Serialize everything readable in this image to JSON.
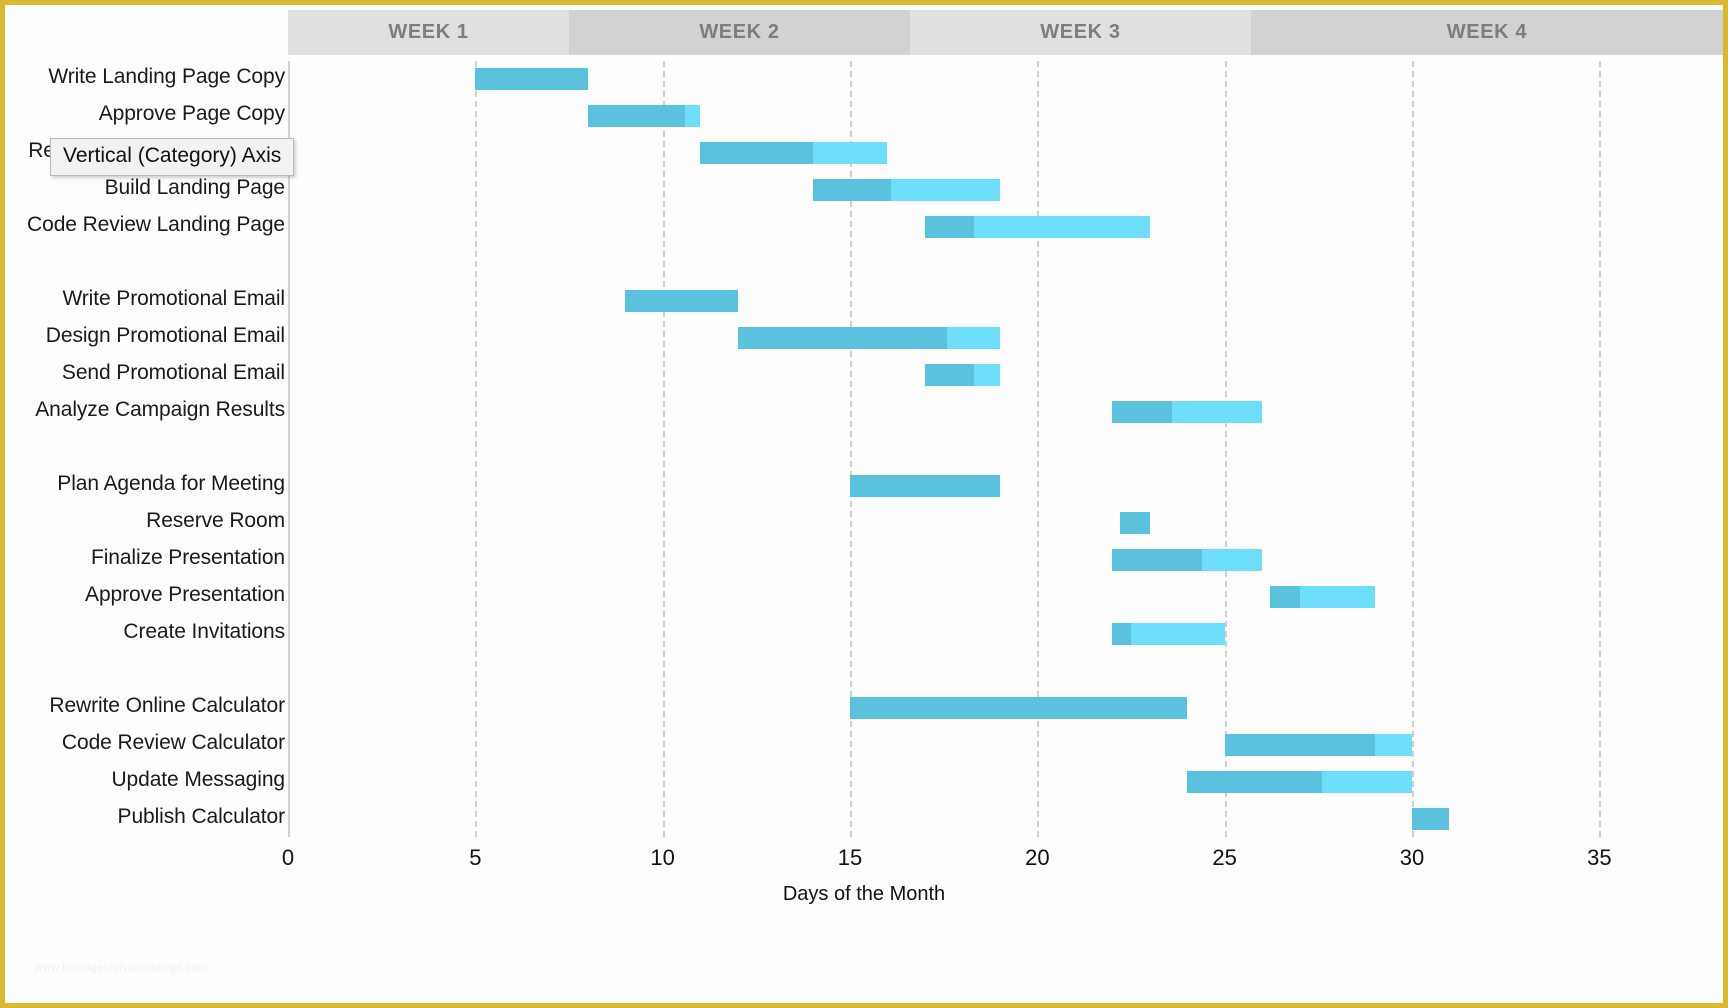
{
  "chart_data": {
    "type": "bar",
    "subtype": "gantt",
    "title": "",
    "xlabel": "Days of the Month",
    "ylabel": "",
    "xlim": [
      0,
      38.3
    ],
    "xticks": [
      0,
      5,
      10,
      15,
      20,
      25,
      30,
      35
    ],
    "xtick_labels": [
      "0",
      "5",
      "10",
      "15",
      "20",
      "25",
      "30",
      "35"
    ],
    "grid": true,
    "gridlines_at": [
      5,
      10,
      15,
      20,
      25,
      30,
      35
    ],
    "legend": [],
    "colors": {
      "complete": "#5BC2DD",
      "remaining": "#6FDEFA",
      "border": "#D8B930",
      "header_light": "#E0E0E0",
      "header_dark": "#D2D2D2",
      "header_text": "#7D7D7D",
      "gridline": "#D3D3D3"
    },
    "week_bands": [
      {
        "label": "WEEK 1",
        "start_day": 0,
        "end_day": 7.5,
        "shade": "light"
      },
      {
        "label": "WEEK 2",
        "start_day": 7.5,
        "end_day": 16.6,
        "shade": "dark"
      },
      {
        "label": "WEEK 3",
        "start_day": 16.6,
        "end_day": 25.7,
        "shade": "light"
      },
      {
        "label": "WEEK 4",
        "start_day": 25.7,
        "end_day": 38.3,
        "shade": "dark"
      }
    ],
    "categories": [
      "Write Landing Page Copy",
      "Approve Page Copy",
      "Review Landing Page Copy",
      "Build Landing Page",
      "Code Review Landing Page",
      "",
      "Write Promotional Email",
      "Design Promotional Email",
      "Send Promotional Email",
      "Analyze Campaign Results",
      "",
      "Plan Agenda for Meeting",
      "Reserve Room",
      "Finalize Presentation",
      "Approve Presentation",
      "Create Invitations",
      "",
      "Rewrite Online Calculator",
      "Code Review Calculator",
      "Update Messaging",
      "Publish Calculator"
    ],
    "tasks": [
      {
        "name": "Write Landing Page Copy",
        "start": 5.0,
        "complete_end": 8.0,
        "end": 8.0
      },
      {
        "name": "Approve Page Copy",
        "start": 8.0,
        "complete_end": 10.6,
        "end": 11.0
      },
      {
        "name": "Review Landing Page Copy",
        "start": 11.0,
        "complete_end": 14.0,
        "end": 16.0
      },
      {
        "name": "Build Landing Page",
        "start": 14.0,
        "complete_end": 16.1,
        "end": 19.0
      },
      {
        "name": "Code Review Landing Page",
        "start": 17.0,
        "complete_end": 18.3,
        "end": 23.0
      },
      {
        "name": "Write Promotional Email",
        "start": 9.0,
        "complete_end": 12.0,
        "end": 12.0
      },
      {
        "name": "Design Promotional Email",
        "start": 12.0,
        "complete_end": 17.6,
        "end": 19.0
      },
      {
        "name": "Send Promotional Email",
        "start": 17.0,
        "complete_end": 18.3,
        "end": 19.0
      },
      {
        "name": "Analyze Campaign Results",
        "start": 22.0,
        "complete_end": 23.6,
        "end": 26.0
      },
      {
        "name": "Plan Agenda for Meeting",
        "start": 15.0,
        "complete_end": 19.0,
        "end": 19.0
      },
      {
        "name": "Reserve Room",
        "start": 22.2,
        "complete_end": 23.0,
        "end": 23.0
      },
      {
        "name": "Finalize Presentation",
        "start": 22.0,
        "complete_end": 24.4,
        "end": 26.0
      },
      {
        "name": "Approve Presentation",
        "start": 26.2,
        "complete_end": 27.0,
        "end": 29.0
      },
      {
        "name": "Create Invitations",
        "start": 22.0,
        "complete_end": 22.5,
        "end": 25.0
      },
      {
        "name": "Rewrite Online Calculator",
        "start": 15.0,
        "complete_end": 24.0,
        "end": 24.0
      },
      {
        "name": "Code Review Calculator",
        "start": 25.0,
        "complete_end": 29.0,
        "end": 30.0
      },
      {
        "name": "Update Messaging",
        "start": 24.0,
        "complete_end": 27.6,
        "end": 30.0
      },
      {
        "name": "Publish Calculator",
        "start": 30.0,
        "complete_end": 31.0,
        "end": 31.0
      }
    ]
  },
  "tooltip": {
    "text": "Vertical (Category) Axis"
  },
  "watermark": {
    "text": "www.heritagechristiancollege.com"
  }
}
